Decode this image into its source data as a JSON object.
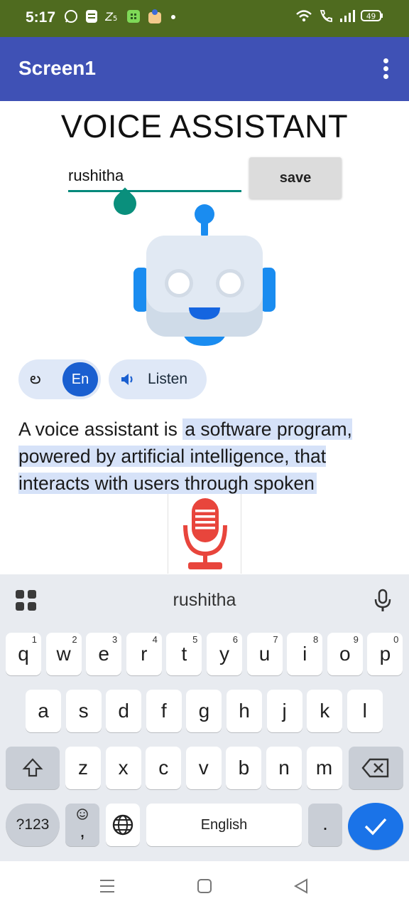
{
  "status_bar": {
    "time": "5:17",
    "battery": "49"
  },
  "app_bar": {
    "title": "Screen1"
  },
  "content": {
    "heading": "VOICE ASSISTANT",
    "name_input_value": "rushitha",
    "save_label": "save",
    "translate": {
      "native_label": "ల",
      "english_label": "En",
      "listen_label": "Listen"
    },
    "paragraph": {
      "plain": "A voice assistant is ",
      "highlighted": "a software program, powered by artificial intelligence, that interacts with users through spoken"
    }
  },
  "keyboard": {
    "suggestion": "rushitha",
    "row1": [
      {
        "k": "q",
        "h": "1"
      },
      {
        "k": "w",
        "h": "2"
      },
      {
        "k": "e",
        "h": "3"
      },
      {
        "k": "r",
        "h": "4"
      },
      {
        "k": "t",
        "h": "5"
      },
      {
        "k": "y",
        "h": "6"
      },
      {
        "k": "u",
        "h": "7"
      },
      {
        "k": "i",
        "h": "8"
      },
      {
        "k": "o",
        "h": "9"
      },
      {
        "k": "p",
        "h": "0"
      }
    ],
    "row2": [
      "a",
      "s",
      "d",
      "f",
      "g",
      "h",
      "j",
      "k",
      "l"
    ],
    "row3": [
      "z",
      "x",
      "c",
      "v",
      "b",
      "n",
      "m"
    ],
    "symbols_label": "?123",
    "comma_label": ",",
    "space_label": "English",
    "period_label": "."
  },
  "colors": {
    "status_bar": "#4f6b1f",
    "app_bar": "#3f51b5",
    "accent_teal": "#00897b",
    "enter_key": "#1a73e8",
    "mic_red": "#e8453c"
  },
  "icons": {
    "status_left": [
      "whatsapp-icon",
      "sim-icon",
      "zomato-icon",
      "app-icon",
      "app-icon-2",
      "dot-icon"
    ],
    "status_right": [
      "wifi-icon",
      "call-icon",
      "signal-icon",
      "battery-icon"
    ],
    "nav": [
      "recents-icon",
      "home-icon",
      "back-icon"
    ]
  }
}
